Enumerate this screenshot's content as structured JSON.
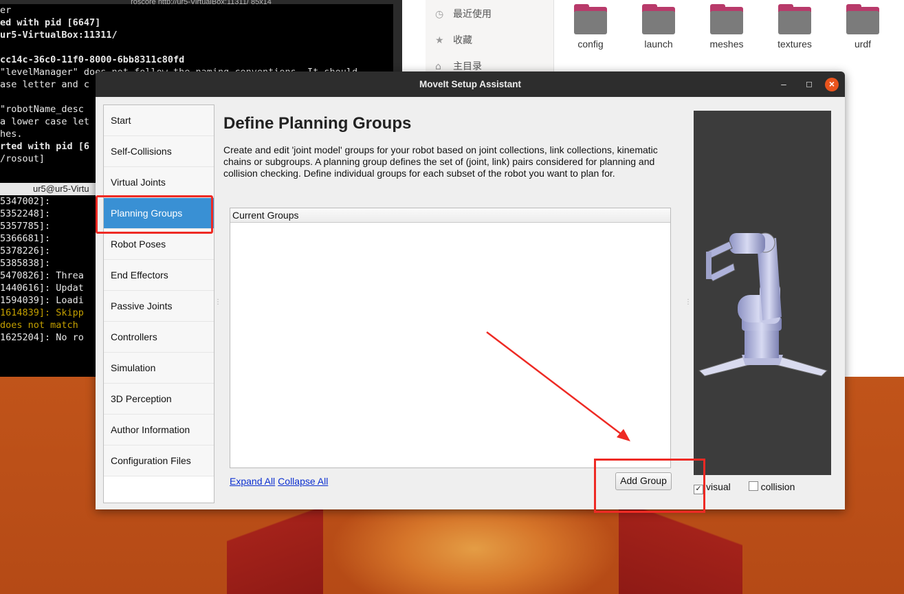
{
  "terminal": {
    "title": "roscore http://ur5-VirtualBox:11311/ 85x14",
    "top_lines": [
      {
        "text": "er",
        "style": ""
      },
      {
        "text": "ed with pid [6647]",
        "style": "b"
      },
      {
        "text": "ur5-VirtualBox:11311/",
        "style": "b"
      },
      {
        "text": "",
        "style": ""
      },
      {
        "text": "cc14c-36c0-11f0-8000-6bb8311c80fd",
        "style": "b"
      },
      {
        "text": "\"levelManager\" does not follow the naming conventions. It should",
        "style": ""
      },
      {
        "text": "ase letter and c",
        "style": ""
      },
      {
        "text": "",
        "style": ""
      },
      {
        "text": "\"robotName_desc",
        "style": ""
      },
      {
        "text": "a lower case let",
        "style": ""
      },
      {
        "text": "hes.",
        "style": ""
      },
      {
        "text": "rted with pid [6",
        "style": "b"
      },
      {
        "text": "/rosout]",
        "style": ""
      }
    ],
    "second_title": "ur5@ur5-Virtu",
    "bottom_lines": [
      {
        "text": "5347002]:",
        "style": ""
      },
      {
        "text": "5352248]:",
        "style": ""
      },
      {
        "text": "5357785]:",
        "style": ""
      },
      {
        "text": "5366681]:",
        "style": ""
      },
      {
        "text": "5378226]:",
        "style": ""
      },
      {
        "text": "5385838]:",
        "style": ""
      },
      {
        "text": "5470826]: Threa",
        "style": ""
      },
      {
        "text": "1440616]: Updat",
        "style": ""
      },
      {
        "text": "1594039]: Loadi",
        "style": ""
      },
      {
        "text": "1614839]: Skipp",
        "style": "y"
      },
      {
        "text": "does not match",
        "style": "y"
      },
      {
        "text": "1625204]: No ro",
        "style": ""
      }
    ]
  },
  "files": {
    "sidebar": [
      {
        "icon": "clock-icon",
        "glyph": "◷",
        "label": "最近使用"
      },
      {
        "icon": "star-icon",
        "glyph": "★",
        "label": "收藏"
      },
      {
        "icon": "home-icon",
        "glyph": "⌂",
        "label": "主目录"
      }
    ],
    "folders": [
      "config",
      "launch",
      "meshes",
      "textures",
      "urdf"
    ]
  },
  "dialog": {
    "title": "MoveIt Setup Assistant",
    "nav": [
      "Start",
      "Self-Collisions",
      "Virtual Joints",
      "Planning Groups",
      "Robot Poses",
      "End Effectors",
      "Passive Joints",
      "Controllers",
      "Simulation",
      "3D Perception",
      "Author Information",
      "Configuration Files"
    ],
    "active_index": 3,
    "heading": "Define Planning Groups",
    "description": "Create and edit 'joint model' groups for your robot based on joint collections, link collections, kinematic chains or subgroups. A planning group defines the set of (joint, link) pairs considered for planning and collision checking. Define individual groups for each subset of the robot you want to plan for.",
    "groups_header": "Current Groups",
    "expand_all": "Expand All",
    "collapse_all": "Collapse All",
    "add_group": "Add Group",
    "visual_label": "visual",
    "visual_checked": true,
    "collision_label": "collision",
    "collision_checked": false
  },
  "colors": {
    "highlight": "#ee2a24",
    "active_nav": "#3990d4"
  }
}
